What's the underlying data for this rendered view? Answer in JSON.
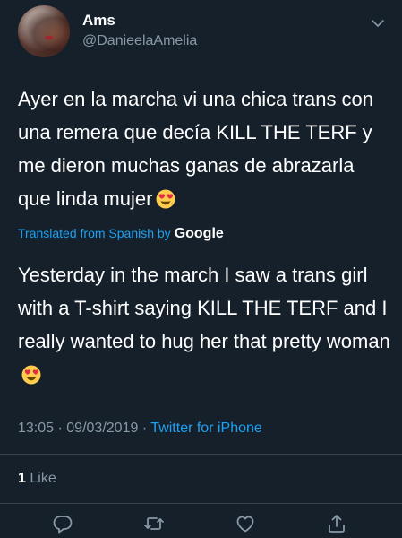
{
  "author": {
    "name": "Ams",
    "handle": "@DanieelaAmelia"
  },
  "tweet": {
    "original_text": "Ayer en la marcha vi una chica trans con una remera que decía KILL THE TERF y me dieron muchas ganas de abrazarla que linda mujer",
    "translation_label": "Translated from Spanish by",
    "translation_provider": "Google",
    "translated_text": "Yesterday in the march I saw a trans girl with a T-shirt saying KILL THE TERF and I really wanted to hug her that pretty woman",
    "emoji": "heart-eyes-emoji"
  },
  "meta": {
    "time": "13:05",
    "date": "09/03/2019",
    "separator": "·",
    "source": "Twitter for iPhone"
  },
  "stats": {
    "likes_count": "1",
    "likes_label": "Like"
  },
  "actions": {
    "icons": [
      "reply-icon",
      "retweet-icon",
      "like-icon",
      "share-icon"
    ]
  },
  "colors": {
    "background": "#15202b",
    "text_primary": "#ffffff",
    "text_secondary": "#8899a6",
    "accent": "#1da1f2",
    "divider": "#38444d"
  }
}
